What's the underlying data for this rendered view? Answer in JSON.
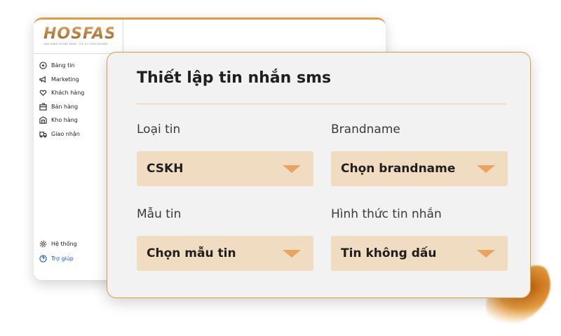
{
  "brand": {
    "logo_text": "HOSFAST",
    "tagline": "VẬN HÀNH THÔNG MINH · TỐI ƯU TRẢI NGHIỆM"
  },
  "sidebar": {
    "items": [
      {
        "label": "Bảng tin",
        "icon": "dashboard-icon"
      },
      {
        "label": "Marketing",
        "icon": "megaphone-icon"
      },
      {
        "label": "Khách hàng",
        "icon": "heart-hand-icon"
      },
      {
        "label": "Bán hàng",
        "icon": "shop-icon"
      },
      {
        "label": "Kho hàng",
        "icon": "warehouse-icon"
      },
      {
        "label": "Giao nhận",
        "icon": "truck-icon"
      }
    ],
    "bottom_items": [
      {
        "label": "Hệ thống",
        "icon": "gear-icon"
      },
      {
        "label": "Trợ giúp",
        "icon": "help-icon"
      }
    ]
  },
  "dialog": {
    "title": "Thiết lập tin nhắn sms",
    "fields": {
      "message_type": {
        "label": "Loại tin",
        "value": "CSKH"
      },
      "brandname": {
        "label": "Brandname",
        "value": "Chọn brandname"
      },
      "template": {
        "label": "Mẫu tin",
        "value": "Chọn mẫu tin"
      },
      "message_format": {
        "label": "Hình thức tin nhắn",
        "value": "Tin không dấu"
      }
    }
  },
  "colors": {
    "accent": "#e39a44",
    "select_bg": "#f0dcc0",
    "caret": "#eaa460",
    "help_link": "#1a5bd6"
  }
}
